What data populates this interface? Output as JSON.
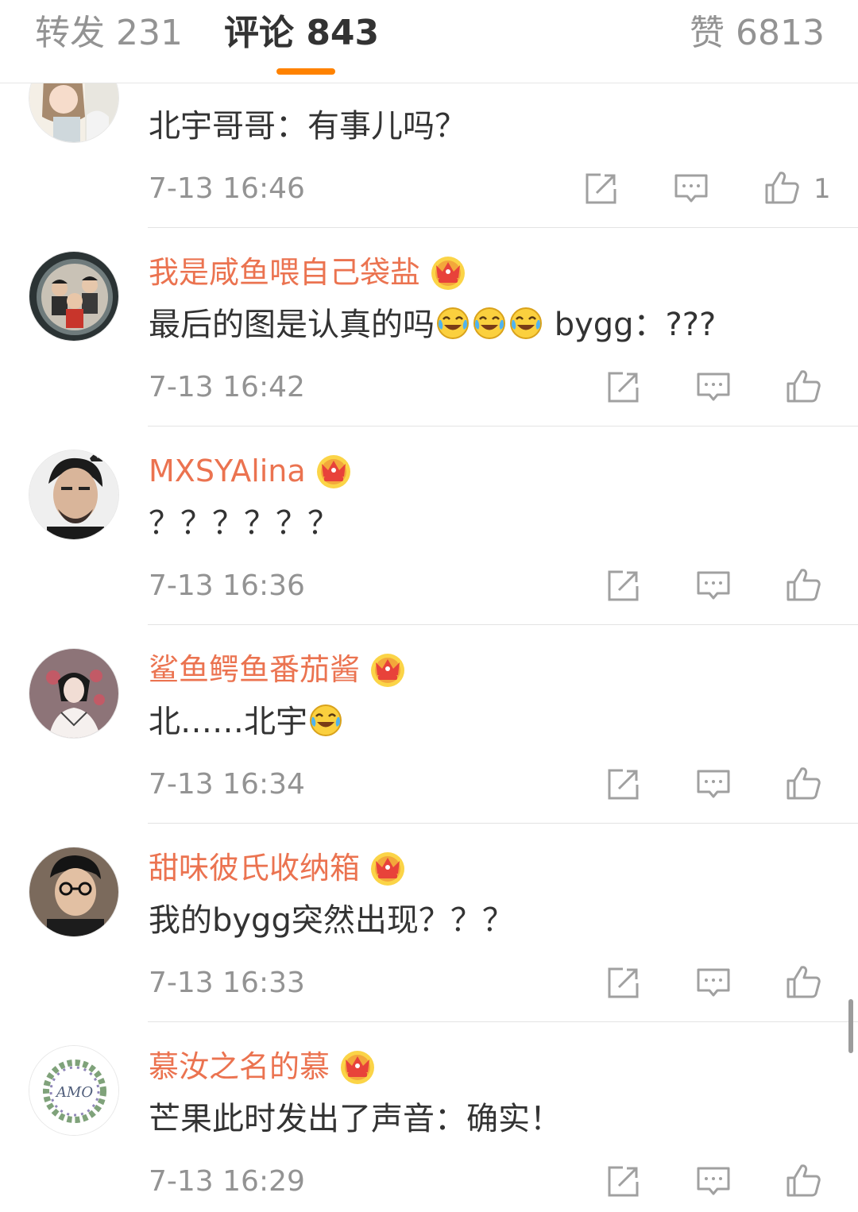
{
  "tabs": {
    "repost": "转发 231",
    "comments": "评论 843",
    "likes": "赞 6813"
  },
  "colors": {
    "accent": "#ff8200",
    "username": "#eb7350",
    "text": "#333333",
    "meta": "#939393"
  },
  "comments": [
    {
      "username": "",
      "text": "北宇哥哥：有事儿吗？",
      "time": "7-13 16:46",
      "like_count": "1",
      "avatar": "anime-girl-avatar"
    },
    {
      "username": "我是咸鱼喂自己袋盐",
      "crown_level": "6",
      "text": "最后的图是认真的吗",
      "text_tail": " bygg：???",
      "emoji_count": 3,
      "time": "7-13 16:42",
      "avatar": "group-photo-avatar"
    },
    {
      "username": "MXSYAlina",
      "crown_level": "4",
      "text": "？？？？？？",
      "time": "7-13 16:36",
      "avatar": "man-portrait-avatar"
    },
    {
      "username": "鲨鱼鳄鱼番茄酱",
      "crown_level": "6",
      "text": "北……北宇",
      "emoji_count": 1,
      "time": "7-13 16:34",
      "avatar": "illustration-avatar"
    },
    {
      "username": "甜味彼氏收纳箱",
      "crown_level": "1",
      "text": "我的bygg突然出现？？？",
      "time": "7-13 16:33",
      "avatar": "glasses-man-avatar"
    },
    {
      "username": "慕汝之名的慕",
      "crown_level": "1",
      "text": "芒果此时发出了声音：确实！",
      "time": "7-13 16:29",
      "avatar": "wreath-logo-avatar"
    }
  ],
  "icons": {
    "repost": "repost-icon",
    "reply": "comment-icon",
    "like": "thumbs-up-icon",
    "crown": "vip-crown-icon",
    "emoji": "laugh-cry-emoji"
  },
  "avatar_text": {
    "wreath": "AMO"
  }
}
